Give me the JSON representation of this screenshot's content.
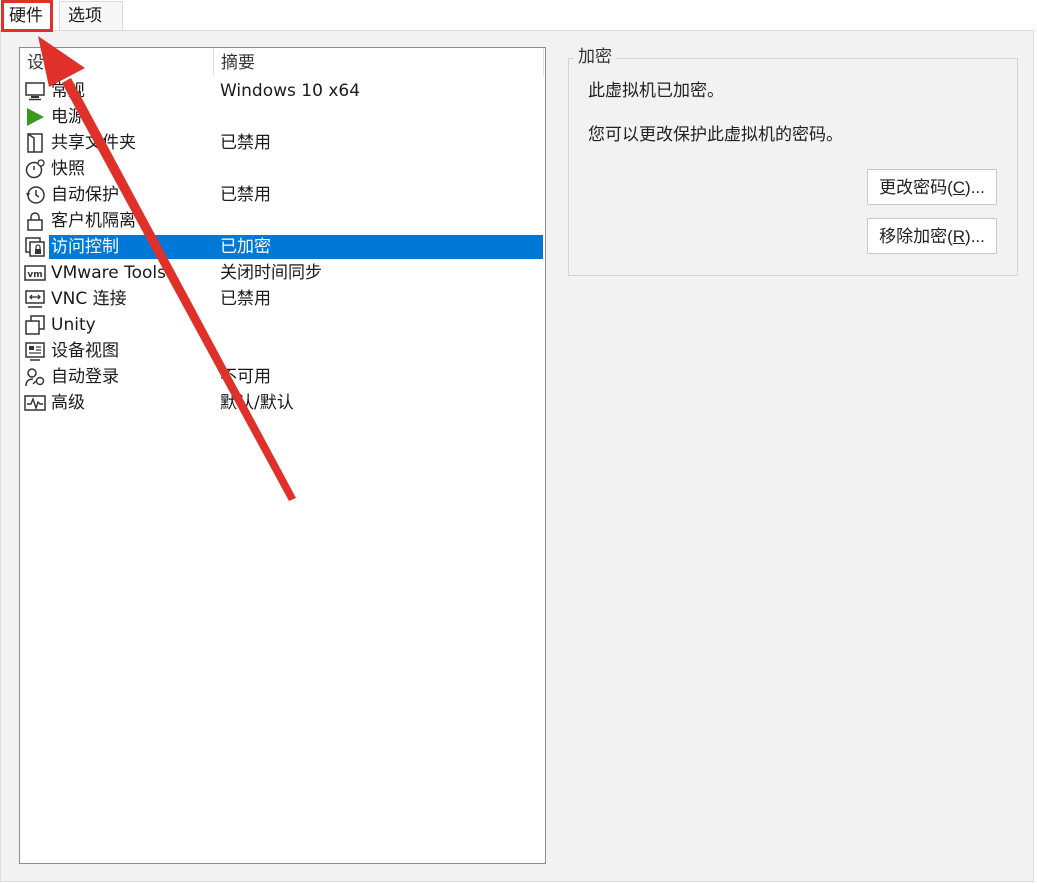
{
  "tabs": [
    {
      "label": "硬件",
      "highlighted": true
    },
    {
      "label": "选项",
      "highlighted": false
    }
  ],
  "list": {
    "headers": {
      "setting": "设置",
      "summary": "摘要"
    },
    "items": [
      {
        "icon": "monitor-icon",
        "name": "常规",
        "summary": "Windows 10 x64"
      },
      {
        "icon": "power-icon",
        "name": "电源",
        "summary": ""
      },
      {
        "icon": "shared-folder-icon",
        "name": "共享文件夹",
        "summary": "已禁用"
      },
      {
        "icon": "snapshot-icon",
        "name": "快照",
        "summary": ""
      },
      {
        "icon": "autoprotect-icon",
        "name": "自动保护",
        "summary": "已禁用"
      },
      {
        "icon": "lock-icon",
        "name": "客户机隔离",
        "summary": ""
      },
      {
        "icon": "access-control-icon",
        "name": "访问控制",
        "summary": "已加密",
        "selected": true
      },
      {
        "icon": "vmware-tools-icon",
        "name": "VMware Tools",
        "summary": "关闭时间同步"
      },
      {
        "icon": "vnc-icon",
        "name": "VNC 连接",
        "summary": "已禁用"
      },
      {
        "icon": "unity-icon",
        "name": "Unity",
        "summary": ""
      },
      {
        "icon": "device-view-icon",
        "name": "设备视图",
        "summary": ""
      },
      {
        "icon": "autologin-icon",
        "name": "自动登录",
        "summary": "不可用"
      },
      {
        "icon": "advanced-icon",
        "name": "高级",
        "summary": "默认/默认"
      }
    ]
  },
  "encryption": {
    "title": "加密",
    "status": "此虚拟机已加密。",
    "hint": "您可以更改保护此虚拟机的密码。",
    "change_button": {
      "label": "更改密码(",
      "mnemonic": "C",
      "suffix": ")..."
    },
    "remove_button": {
      "label": "移除加密(",
      "mnemonic": "R",
      "suffix": ")..."
    }
  },
  "colors": {
    "selection": "#0078d7",
    "annotation": "#e0302a",
    "play_green": "#3a9a1f"
  }
}
